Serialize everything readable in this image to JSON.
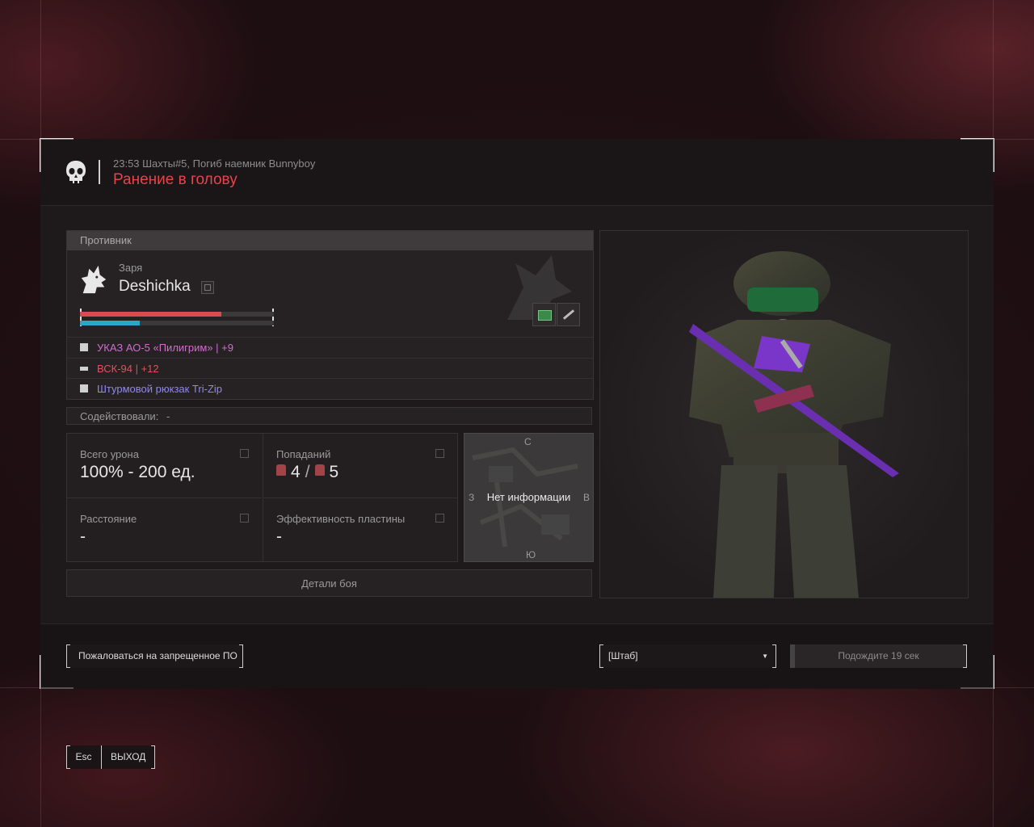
{
  "header": {
    "event_line": "23:53 Шахты#5, Погиб наемник Bunnyboy",
    "cause": "Ранение в голову"
  },
  "enemy": {
    "section_title": "Противник",
    "clan": "Заря",
    "nickname": "Deshichka",
    "health_fraction": 0.73,
    "armor_fraction": 0.31,
    "equipment": [
      {
        "icon": "armor-icon",
        "text": "УКАЗ АО-5 «Пилигрим» | +9",
        "color": "#d36bd0"
      },
      {
        "icon": "rifle-icon",
        "text": "ВСК-94 | +12",
        "color": "#e0525a"
      },
      {
        "icon": "backpack-icon",
        "text": "Штурмовой рюкзак Tri-Zip",
        "color": "#8f86f0"
      }
    ]
  },
  "assist": {
    "label": "Содействовали:",
    "value": "-"
  },
  "stats": {
    "total_damage_label": "Всего урона",
    "total_damage_value": "100% - 200 ед.",
    "hits_label": "Попаданий",
    "hits_a": "4",
    "hits_b": "5",
    "distance_label": "Расстояние",
    "distance_value": "-",
    "plate_label": "Эффективность пластины",
    "plate_value": "-"
  },
  "minimap": {
    "north": "С",
    "south": "Ю",
    "west": "З",
    "east": "В",
    "message": "Нет информации"
  },
  "details_button": "Детали боя",
  "footer": {
    "report_button": "Пожаловаться на запрещенное ПО",
    "select_value": "[Штаб]",
    "wait_button": "Подождите 19 сек"
  },
  "exit": {
    "key": "Esc",
    "label": "ВЫХОД"
  }
}
